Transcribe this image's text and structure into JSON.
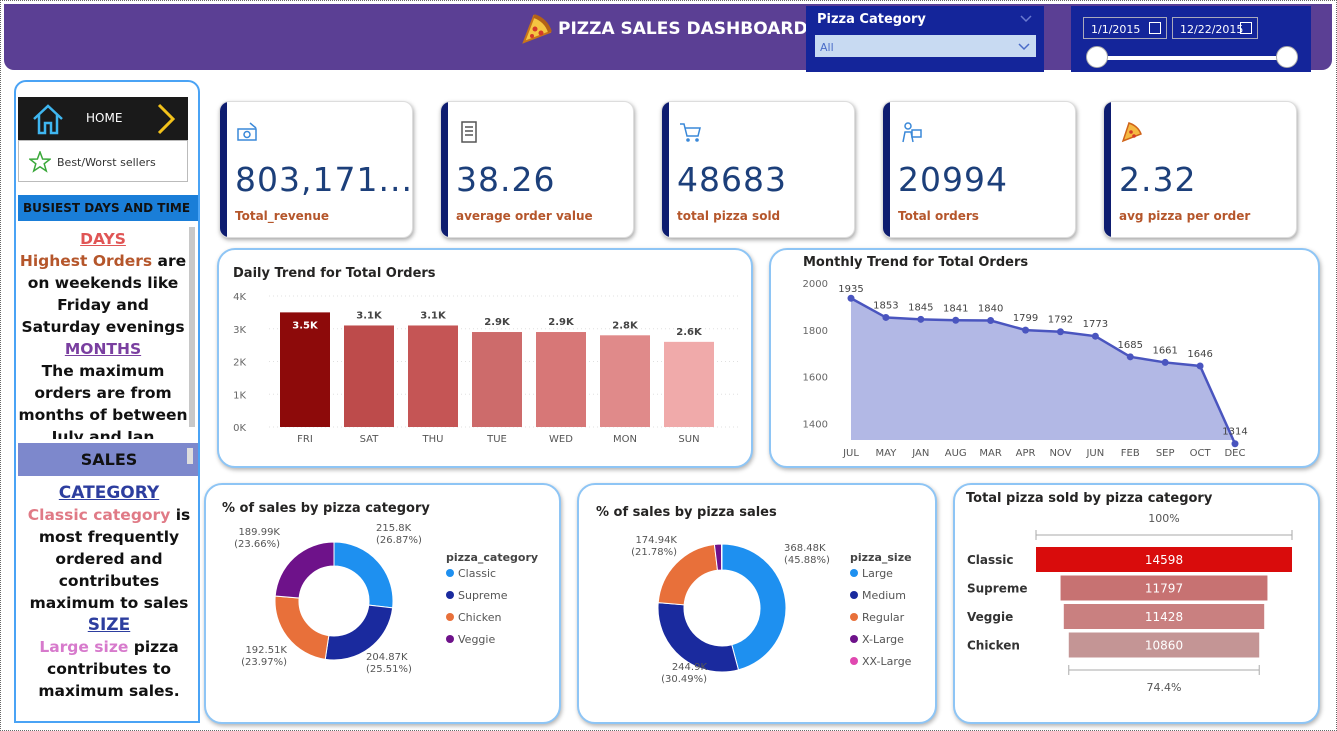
{
  "header": {
    "title": "PIZZA SALES DASHBOARD"
  },
  "slicer": {
    "label": "Pizza Category",
    "value": "All"
  },
  "date_range": {
    "start": "1/1/2015",
    "end": "12/22/2015"
  },
  "sidebar": {
    "home_label": "HOME",
    "best_worst_label": "Best/Worst sellers",
    "busiest_heading": "BUSIEST DAYS AND TIME",
    "days_heading": "DAYS",
    "days_highlight": "Highest Orders",
    "days_text_1": " are on weekends like Friday and Saturday evenings",
    "months_heading": "MONTHS",
    "months_text": "The maximum orders are from months of between July and Jan",
    "sales_heading": "SALES",
    "category_heading": "CATEGORY",
    "category_highlight": "Classic category",
    "category_text": " is most frequently ordered and contributes maximum to sales",
    "size_heading": "SIZE",
    "size_highlight": "Large size",
    "size_text": " pizza contributes to maximum sales."
  },
  "kpis": [
    {
      "value": "803,171....",
      "label": "Total_revenue",
      "icon": "money-icon"
    },
    {
      "value": "38.26",
      "label": "average order value",
      "icon": "receipt-icon"
    },
    {
      "value": "48683",
      "label": "total pizza sold",
      "icon": "cart-icon"
    },
    {
      "value": "20994",
      "label": "Total orders",
      "icon": "delivery-icon"
    },
    {
      "value": "2.32",
      "label": "avg pizza per order",
      "icon": "pizza-icon"
    }
  ],
  "colors": {
    "header": "#5b3f94",
    "accent": "#14259a",
    "kpi_value": "#1c3f7a",
    "kpi_label": "#b5562b"
  },
  "chart_data": [
    {
      "type": "bar",
      "title": "Daily Trend for Total Orders",
      "categories": [
        "FRI",
        "SAT",
        "THU",
        "TUE",
        "WED",
        "MON",
        "SUN"
      ],
      "values": [
        3500,
        3100,
        3100,
        2900,
        2900,
        2800,
        2600
      ],
      "data_labels": [
        "3.5K",
        "3.1K",
        "3.1K",
        "2.9K",
        "2.9K",
        "2.8K",
        "2.6K"
      ],
      "colors": [
        "#8d0a0a",
        "#bd4b4b",
        "#c55555",
        "#cd6b6b",
        "#d77777",
        "#e08a8a",
        "#f0aaaa"
      ],
      "yticks": [
        "0K",
        "1K",
        "2K",
        "3K",
        "4K"
      ],
      "ylim": [
        0,
        4000
      ]
    },
    {
      "type": "area",
      "title": "Monthly Trend for Total Orders",
      "categories": [
        "JUL",
        "MAY",
        "JAN",
        "AUG",
        "MAR",
        "APR",
        "NOV",
        "JUN",
        "FEB",
        "SEP",
        "OCT",
        "DEC"
      ],
      "values": [
        1935,
        1853,
        1845,
        1841,
        1840,
        1799,
        1792,
        1773,
        1685,
        1661,
        1646,
        1314
      ],
      "yticks": [
        "1400",
        "1600",
        "1800",
        "2000"
      ],
      "ylim": [
        1330,
        2000
      ],
      "color": "#4a55bf",
      "fill": "#aab0e2"
    },
    {
      "type": "pie",
      "title": "% of sales by pizza category",
      "legend_title": "pizza_category",
      "slices": [
        {
          "name": "Classic",
          "value": 215.8,
          "label": "215.8K",
          "pct": "(26.87%)",
          "color": "#1e90f0"
        },
        {
          "name": "Supreme",
          "value": 204.87,
          "label": "204.87K",
          "pct": "(25.51%)",
          "color": "#1a2a9e"
        },
        {
          "name": "Chicken",
          "value": 192.51,
          "label": "192.51K",
          "pct": "(23.97%)",
          "color": "#e8703a"
        },
        {
          "name": "Veggie",
          "value": 189.99,
          "label": "189.99K",
          "pct": "(23.66%)",
          "color": "#6e128a"
        }
      ]
    },
    {
      "type": "pie",
      "title": "% of sales by pizza sales",
      "legend_title": "pizza_size",
      "slices": [
        {
          "name": "Large",
          "value": 368.48,
          "label": "368.48K",
          "pct": "(45.88%)",
          "color": "#1e90f0"
        },
        {
          "name": "Medium",
          "value": 244.9,
          "label": "244.9K",
          "pct": "(30.49%)",
          "color": "#1a2a9e"
        },
        {
          "name": "Regular",
          "value": 174.94,
          "label": "174.94K",
          "pct": "(21.78%)",
          "color": "#e8703a"
        },
        {
          "name": "X-Large",
          "value": 14.2,
          "label": "",
          "pct": "",
          "color": "#6e128a"
        },
        {
          "name": "XX-Large",
          "value": 1.0,
          "label": "",
          "pct": "",
          "color": "#e048b0"
        }
      ]
    },
    {
      "type": "bar",
      "title": "Total pizza sold by pizza category",
      "categories": [
        "Classic",
        "Supreme",
        "Veggie",
        "Chicken"
      ],
      "values": [
        14598,
        11797,
        11428,
        10860
      ],
      "data_labels": [
        "14598",
        "11797",
        "11428",
        "10860"
      ],
      "colors": [
        "#d90c0c",
        "#c77272",
        "#c98080",
        "#c49595"
      ],
      "top_label": "100%",
      "bottom_label": "74.4%"
    }
  ]
}
